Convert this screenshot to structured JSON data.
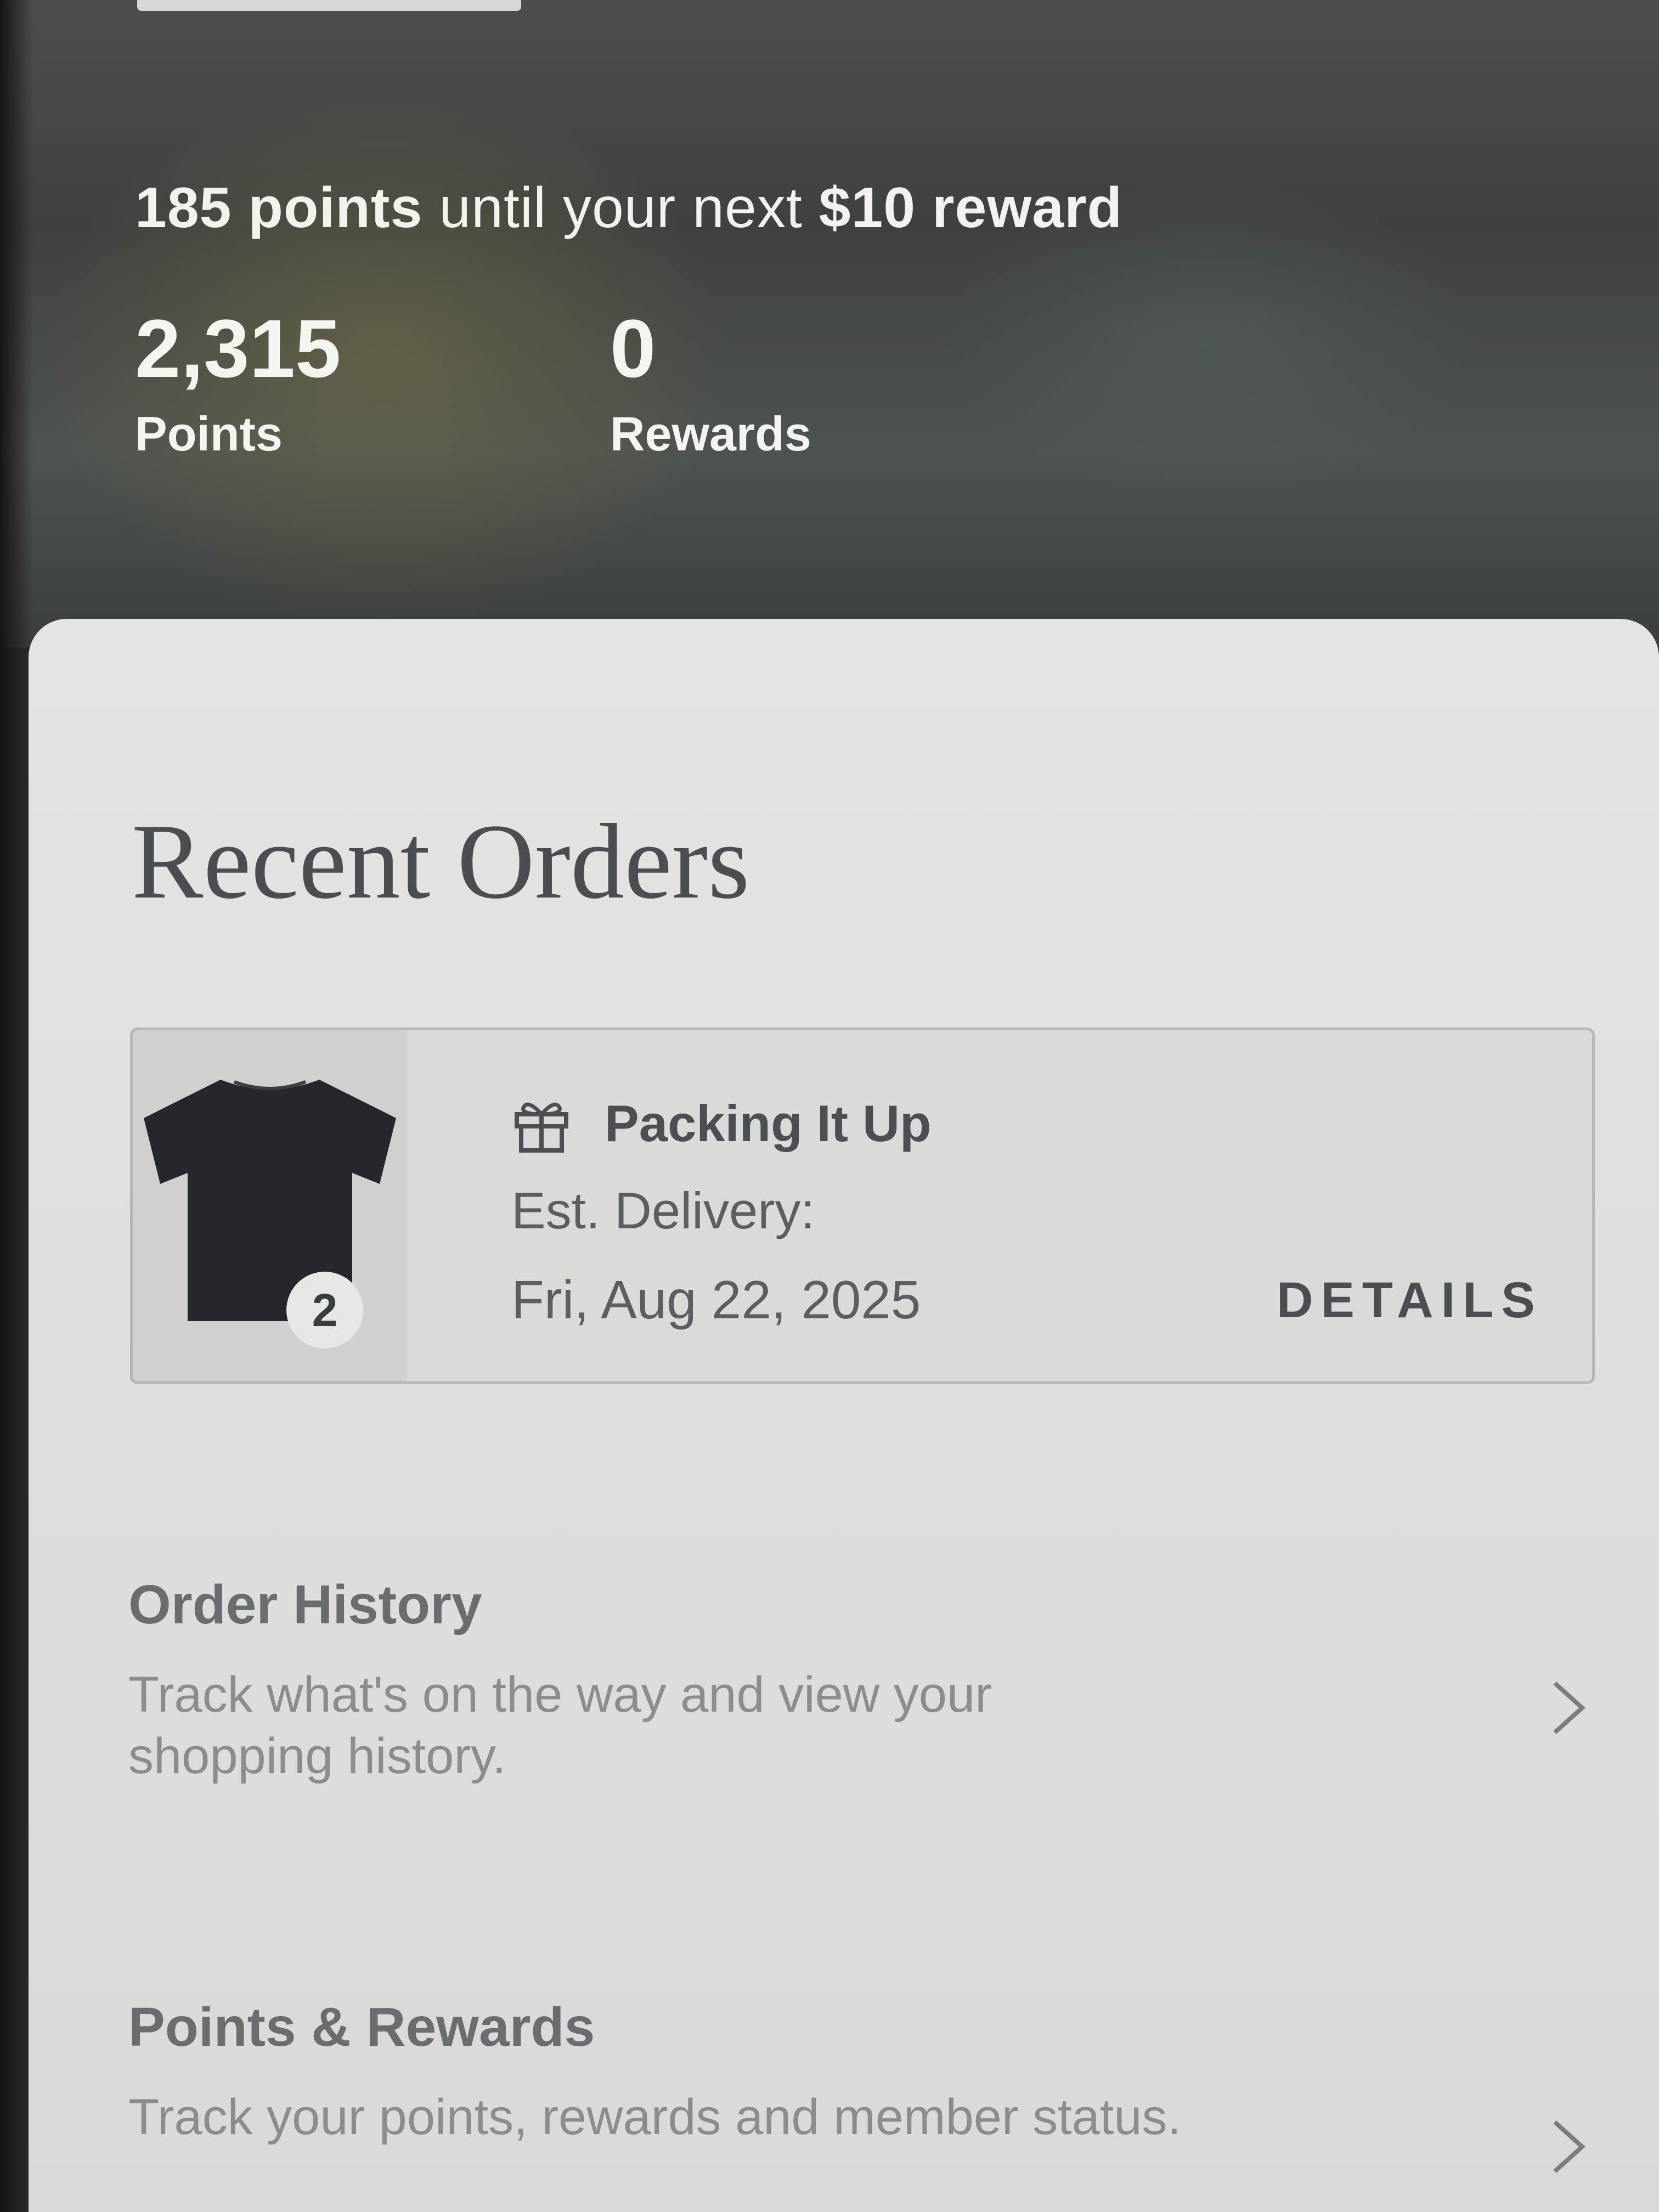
{
  "hero": {
    "reward_points_needed": "185 points",
    "reward_middle": " until your next ",
    "reward_amount": "$10 reward",
    "points_value": "2,315",
    "points_label": "Points",
    "rewards_value": "0",
    "rewards_label": "Rewards"
  },
  "recent_orders": {
    "title": "Recent Orders",
    "orders": [
      {
        "item_count": "2",
        "status": "Packing It Up",
        "delivery_label": "Est. Delivery:",
        "delivery_date": "Fri, Aug 22, 2025",
        "details_label": "DETAILS"
      }
    ]
  },
  "links": [
    {
      "title": "Order History",
      "description": "Track what's on the way and view your shopping history."
    },
    {
      "title": "Points & Rewards",
      "description": "Track your points, rewards and member status."
    }
  ],
  "icons": {
    "status": "gift-box-icon",
    "product": "t-shirt-icon",
    "chevron": "chevron-right-icon"
  }
}
